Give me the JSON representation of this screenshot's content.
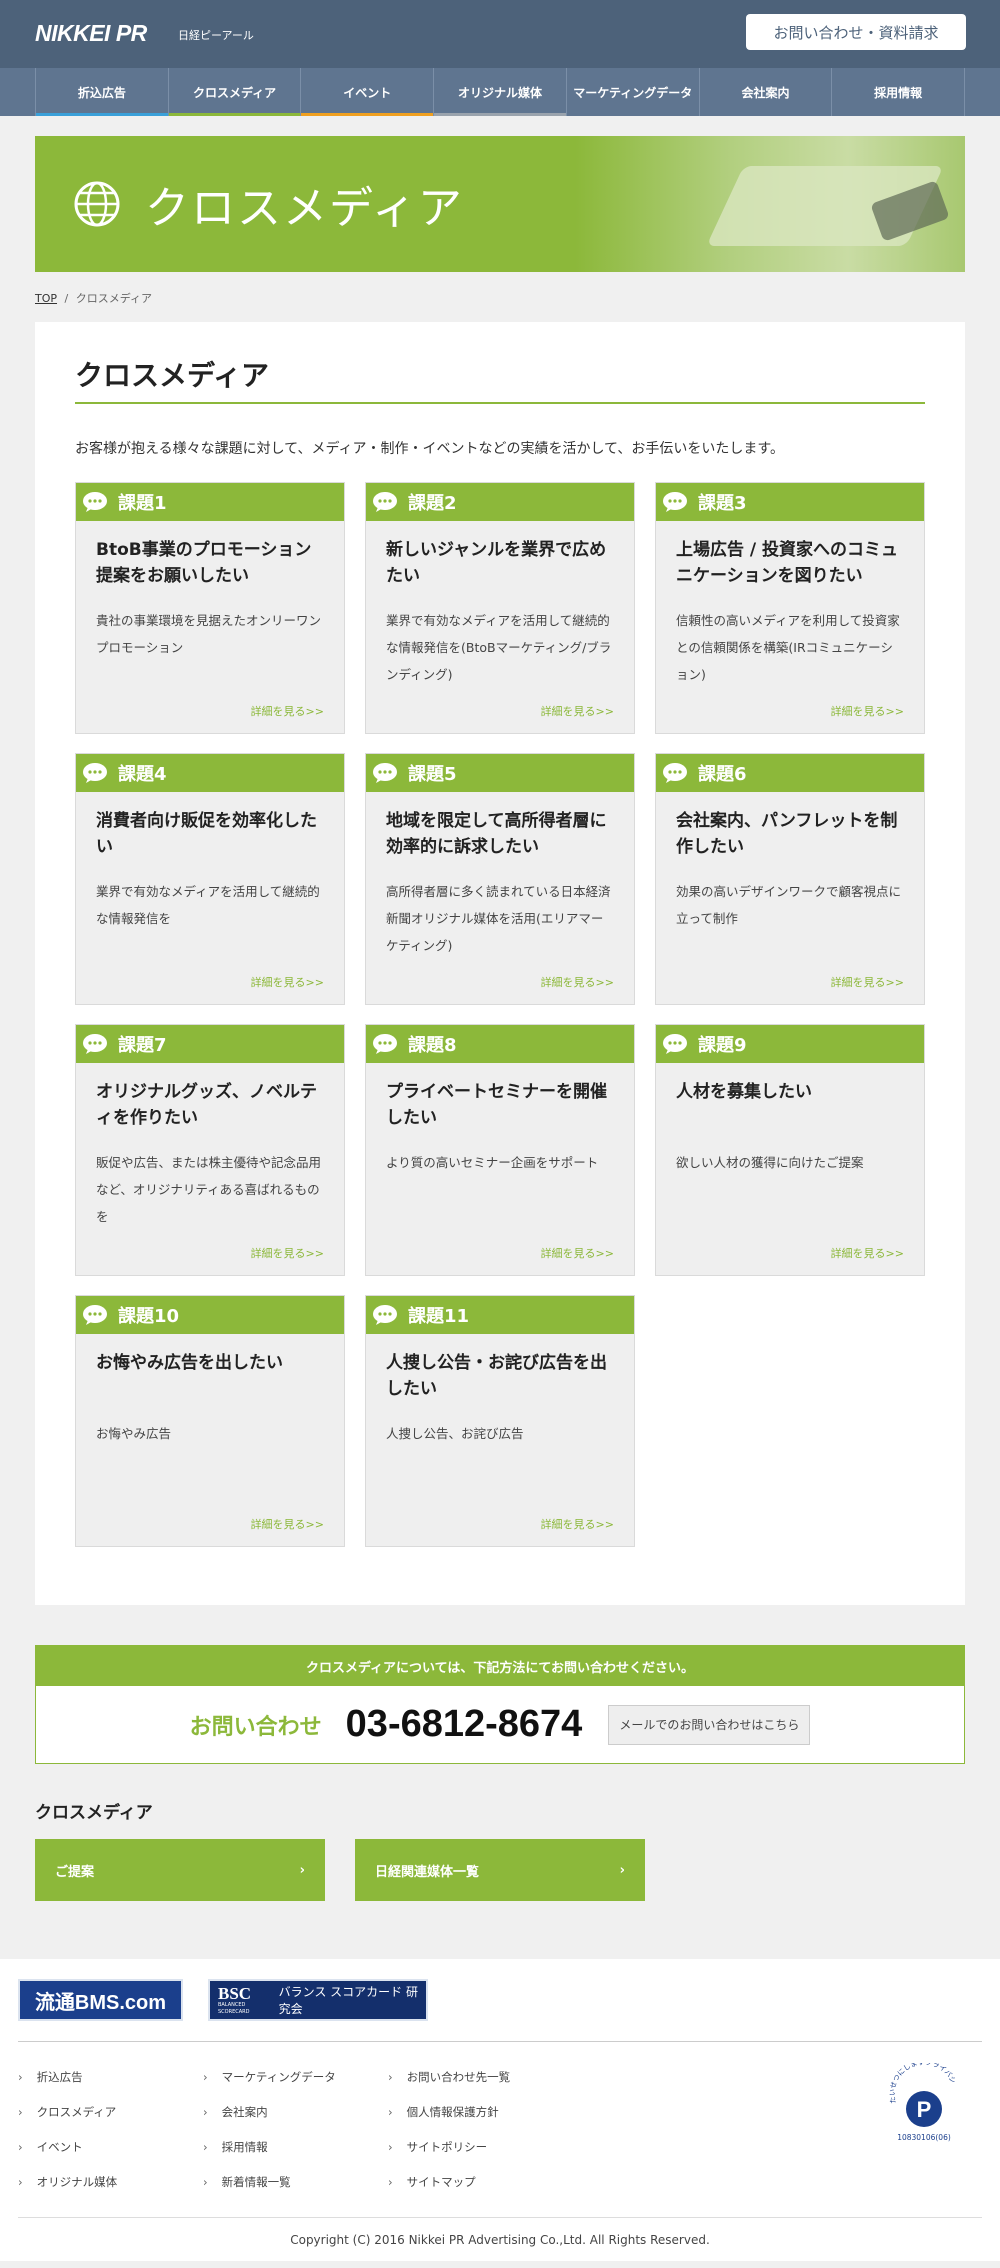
{
  "header": {
    "logo": "NIKKEI PR",
    "logo_sub": "日経ピーアール",
    "contact_button": "お問い合わせ・資料請求"
  },
  "gnav": [
    {
      "label": "折込広告",
      "bar": "#3aa0d9"
    },
    {
      "label": "クロスメディア",
      "bar": "#8cb83a"
    },
    {
      "label": "イベント",
      "bar": "#f0a020"
    },
    {
      "label": "オリジナル媒体",
      "bar": "#9aa3ad"
    },
    {
      "label": "マーケティングデータ",
      "bar": ""
    },
    {
      "label": "会社案内",
      "bar": ""
    },
    {
      "label": "採用情報",
      "bar": ""
    }
  ],
  "hero": {
    "title": "クロスメディア",
    "icon": "globe-icon"
  },
  "breadcrumb": {
    "top": "TOP",
    "sep": "/",
    "current": "クロスメディア"
  },
  "main": {
    "title": "クロスメディア",
    "intro": "お客様が抱える様々な課題に対して、メディア・制作・イベントなどの実績を活かして、お手伝いをいたします。",
    "more": "詳細を見る>>",
    "cards": [
      {
        "label": "課題1",
        "title": "BtoB事業のプロモーション提案をお願いしたい",
        "desc": "貴社の事業環境を見据えたオンリーワンプロモーション"
      },
      {
        "label": "課題2",
        "title": "新しいジャンルを業界で広めたい",
        "desc": "業界で有効なメディアを活用して継続的な情報発信を(BtoBマーケティング/ブランディング)"
      },
      {
        "label": "課題3",
        "title": "上場広告 / 投資家へのコミュニケーションを図りたい",
        "desc": "信頼性の高いメディアを利用して投資家との信頼関係を構築(IRコミュニケーション)"
      },
      {
        "label": "課題4",
        "title": "消費者向け販促を効率化したい",
        "desc": "業界で有効なメディアを活用して継続的な情報発信を"
      },
      {
        "label": "課題5",
        "title": "地域を限定して高所得者層に効率的に訴求したい",
        "desc": "高所得者層に多く読まれている日本経済新聞オリジナル媒体を活用(エリアマーケティング)"
      },
      {
        "label": "課題6",
        "title": "会社案内、パンフレットを制作したい",
        "desc": "効果の高いデザインワークで顧客視点に立って制作"
      },
      {
        "label": "課題7",
        "title": "オリジナルグッズ、ノベルティを作りたい",
        "desc": "販促や広告、または株主優待や記念品用など、オリジナリティある喜ばれるものを"
      },
      {
        "label": "課題8",
        "title": "プライベートセミナーを開催したい",
        "desc": "より質の高いセミナー企画をサポート"
      },
      {
        "label": "課題9",
        "title": "人材を募集したい",
        "desc": "欲しい人材の獲得に向けたご提案"
      },
      {
        "label": "課題10",
        "title": "お悔やみ広告を出したい",
        "desc": "お悔やみ広告"
      },
      {
        "label": "課題11",
        "title": "人捜し公告・お詫び広告を出したい",
        "desc": "人捜し公告、お詫び広告"
      }
    ]
  },
  "inquiry": {
    "head": "クロスメディアについては、下記方法にてお問い合わせください。",
    "label": "お問い合わせ",
    "tel": "03-6812-8674",
    "mail_button": "メールでのお問い合わせはこちら"
  },
  "sub": {
    "title": "クロスメディア",
    "buttons": [
      "ご提案",
      "日経関連媒体一覧"
    ],
    "arrow": "›"
  },
  "footer": {
    "banner1": "流通BMS.com",
    "banner2_main": "BSC",
    "banner2_text": "バランス スコアカード 研究会",
    "banner2_small": "BALANCED SCORECARD",
    "col1": [
      "折込広告",
      "クロスメディア",
      "イベント",
      "オリジナル媒体"
    ],
    "col2": [
      "マーケティングデータ",
      "会社案内",
      "採用情報",
      "新着情報一覧"
    ],
    "col3": [
      "お問い合わせ先一覧",
      "個人情報保護方針",
      "サイトポリシー",
      "サイトマップ"
    ],
    "privacy_top": "たいせつにしますプライバシー",
    "privacy_num": "10830106(06)",
    "copyright": "Copyright (C) 2016 Nikkei PR Advertising Co.,Ltd. All Rights Reserved."
  },
  "colors": {
    "accent": "#8cb83a",
    "header": "#4d627a",
    "nav": "#5f7590"
  }
}
